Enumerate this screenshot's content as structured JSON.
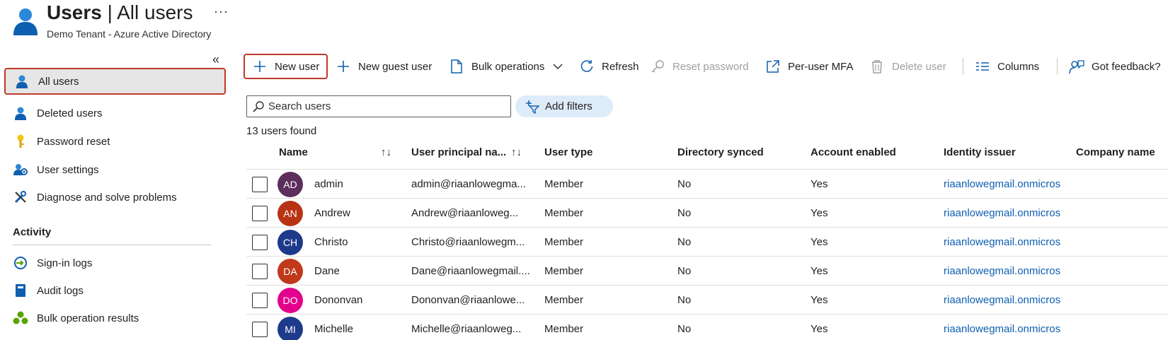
{
  "header": {
    "title_bold": "Users",
    "title_rest": " | All users",
    "more": "···",
    "subtitle": "Demo Tenant - Azure Active Directory",
    "collapse": "«"
  },
  "sidebar": {
    "items": [
      {
        "label": "All users",
        "icon": "user-icon"
      },
      {
        "label": "Deleted users",
        "icon": "user-icon"
      },
      {
        "label": "Password reset",
        "icon": "key-icon"
      },
      {
        "label": "User settings",
        "icon": "user-settings-icon"
      },
      {
        "label": "Diagnose and solve problems",
        "icon": "wrench-icon"
      }
    ],
    "activity_title": "Activity",
    "activity_items": [
      {
        "label": "Sign-in logs",
        "icon": "sign-in-icon"
      },
      {
        "label": "Audit logs",
        "icon": "book-icon"
      },
      {
        "label": "Bulk operation results",
        "icon": "bulk-results-icon"
      }
    ]
  },
  "toolbar": {
    "new_user": "New user",
    "new_guest_user": "New guest user",
    "bulk_operations": "Bulk operations",
    "refresh": "Refresh",
    "reset_password": "Reset password",
    "per_user_mfa": "Per-user MFA",
    "delete_user": "Delete user",
    "columns": "Columns",
    "got_feedback": "Got feedback?"
  },
  "search": {
    "placeholder": "Search users",
    "add_filters": "Add filters"
  },
  "count_text": "13 users found",
  "table": {
    "columns": [
      "Name",
      "User principal na...",
      "User type",
      "Directory synced",
      "Account enabled",
      "Identity issuer",
      "Company name"
    ],
    "rows": [
      {
        "initials": "AD",
        "name": "admin",
        "upn": "admin@riaanlowegma...",
        "type": "Member",
        "synced": "No",
        "enabled": "Yes",
        "issuer": "riaanlowegmail.onmicros",
        "color": "#5c2e5c"
      },
      {
        "initials": "AN",
        "name": "Andrew",
        "upn": "Andrew@riaanloweg...",
        "type": "Member",
        "synced": "No",
        "enabled": "Yes",
        "issuer": "riaanlowegmail.onmicros",
        "color": "#b83214"
      },
      {
        "initials": "CH",
        "name": "Christo",
        "upn": "Christo@riaanlowegm...",
        "type": "Member",
        "synced": "No",
        "enabled": "Yes",
        "issuer": "riaanlowegmail.onmicros",
        "color": "#1e3a8a"
      },
      {
        "initials": "DA",
        "name": "Dane",
        "upn": "Dane@riaanlowegmail....",
        "type": "Member",
        "synced": "No",
        "enabled": "Yes",
        "issuer": "riaanlowegmail.onmicros",
        "color": "#c0391b"
      },
      {
        "initials": "DO",
        "name": "Dononvan",
        "upn": "Dononvan@riaanlowe...",
        "type": "Member",
        "synced": "No",
        "enabled": "Yes",
        "issuer": "riaanlowegmail.onmicros",
        "color": "#e3008c"
      },
      {
        "initials": "MI",
        "name": "Michelle",
        "upn": "Michelle@riaanloweg...",
        "type": "Member",
        "synced": "No",
        "enabled": "Yes",
        "issuer": "riaanlowegmail.onmicros",
        "color": "#1e3a8a"
      }
    ]
  }
}
